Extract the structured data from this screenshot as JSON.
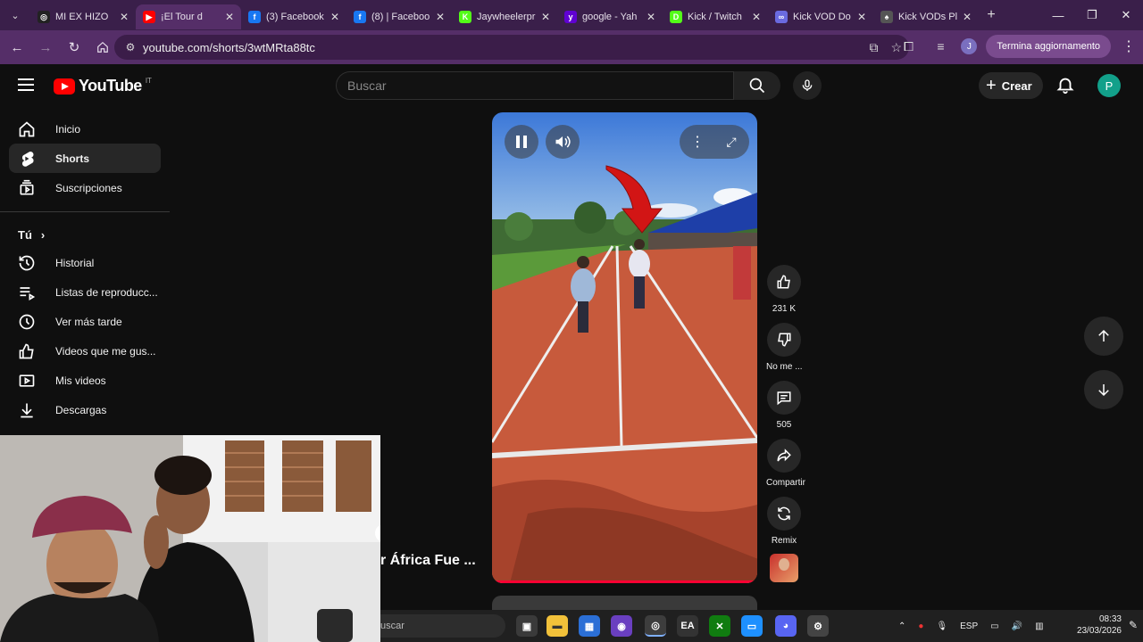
{
  "browser": {
    "tabs": [
      {
        "title": "MI EX HIZO",
        "favicon_color": "#222222",
        "favicon_glyph": "◎",
        "active": false
      },
      {
        "title": "¡El Tour d",
        "favicon_color": "#ff0000",
        "favicon_glyph": "▶",
        "active": true
      },
      {
        "title": "(3) Facebook",
        "favicon_color": "#1877f2",
        "favicon_glyph": "f",
        "active": false
      },
      {
        "title": "(8) | Faceboo",
        "favicon_color": "#1877f2",
        "favicon_glyph": "f",
        "active": false
      },
      {
        "title": "Jaywheelerpr",
        "favicon_color": "#53fc18",
        "favicon_glyph": "K",
        "active": false
      },
      {
        "title": "google - Yah",
        "favicon_color": "#6001d2",
        "favicon_glyph": "y",
        "active": false
      },
      {
        "title": "Kick / Twitch",
        "favicon_color": "#53fc18",
        "favicon_glyph": "D",
        "active": false
      },
      {
        "title": "Kick VOD Do",
        "favicon_color": "#6a6adf",
        "favicon_glyph": "∞",
        "active": false
      },
      {
        "title": "Kick VODs Pl",
        "favicon_color": "#555555",
        "favicon_glyph": "♠",
        "active": false
      }
    ],
    "url": "youtube.com/shorts/3wtMRta88tc",
    "update_button": "Termina aggiornamento",
    "profile_initial": "J"
  },
  "youtube": {
    "logo_text": "YouTube",
    "country_code": "IT",
    "search_placeholder": "Buscar",
    "create_label": "Crear",
    "avatar_initial": "P"
  },
  "sidebar": {
    "main": [
      {
        "label": "Inicio",
        "icon": "home-icon",
        "active": false
      },
      {
        "label": "Shorts",
        "icon": "shorts-icon",
        "active": true
      },
      {
        "label": "Suscripciones",
        "icon": "subscriptions-icon",
        "active": false
      }
    ],
    "you_heading": "Tú",
    "you": [
      {
        "label": "Historial",
        "icon": "history-icon"
      },
      {
        "label": "Listas de reproducc...",
        "icon": "playlist-icon"
      },
      {
        "label": "Ver más tarde",
        "icon": "clock-icon"
      },
      {
        "label": "Videos que me gus...",
        "icon": "thumbs-up-icon"
      },
      {
        "label": "Mis videos",
        "icon": "my-videos-icon"
      },
      {
        "label": "Descargas",
        "icon": "download-icon"
      }
    ]
  },
  "short": {
    "progress": 0.99,
    "actions": {
      "likes": "231 K",
      "dislike_label": "No me ...",
      "comments": "505",
      "share_label": "Compartir",
      "remix_label": "Remix"
    },
    "overlay_title": "r África Fue ..."
  },
  "taskbar": {
    "search_text": "uscar",
    "language": "ESP",
    "time": "08:33",
    "date": "23/03/2026"
  },
  "colors": {
    "browser_frame": "#3a1f4a",
    "toolbar": "#552e68",
    "youtube_red": "#ff0000",
    "progress_red": "#ff0033",
    "avatar": "#12a08a"
  }
}
